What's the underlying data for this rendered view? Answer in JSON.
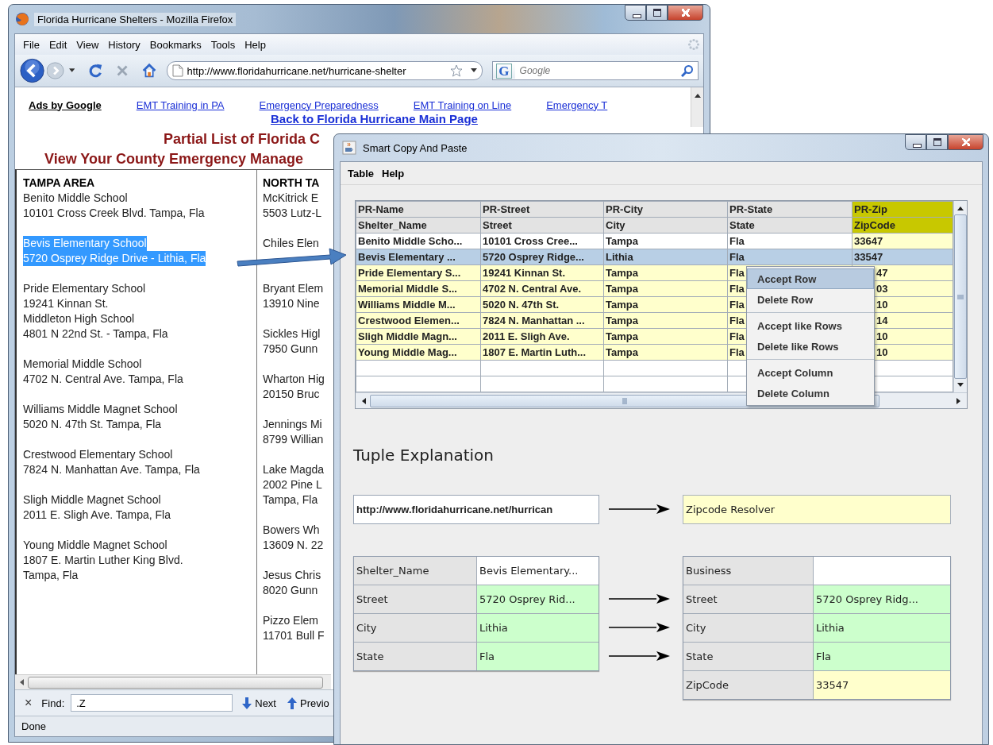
{
  "browser": {
    "title": "Florida Hurricane Shelters - Mozilla Firefox",
    "menu": [
      "File",
      "Edit",
      "View",
      "History",
      "Bookmarks",
      "Tools",
      "Help"
    ],
    "url": "http://www.floridahurricane.net/hurricane-shelter",
    "search_engine": "G",
    "search_placeholder": "Google",
    "ads_label": "Ads by Google",
    "ads": [
      "EMT Training in PA",
      "Emergency Preparedness",
      "EMT Training on Line",
      "Emergency T"
    ],
    "back_link": "Back to Florida Hurricane Main Page",
    "headings": [
      "Partial List of Florida C",
      "View Your County Emergency Manage"
    ],
    "columns": [
      {
        "heading": "TAMPA AREA",
        "entries": [
          {
            "lines": [
              "Benito Middle School",
              "10101 Cross Creek Blvd. Tampa, Fla"
            ],
            "selected": false
          },
          {
            "lines": [
              "Bevis Elementary School",
              "5720 Osprey Ridge Drive - Lithia, Fla"
            ],
            "selected": true
          },
          {
            "lines": [
              "Pride Elementary School",
              "19241 Kinnan St.",
              "Middleton High School",
              "4801 N 22nd St. - Tampa, Fla"
            ],
            "selected": false
          },
          {
            "lines": [
              "Memorial Middle School",
              "4702 N. Central Ave. Tampa, Fla"
            ],
            "selected": false
          },
          {
            "lines": [
              "Williams Middle Magnet School",
              "5020 N. 47th St. Tampa, Fla"
            ],
            "selected": false
          },
          {
            "lines": [
              "Crestwood Elementary School",
              "7824 N. Manhattan Ave. Tampa, Fla"
            ],
            "selected": false
          },
          {
            "lines": [
              "Sligh Middle Magnet School",
              "2011 E. Sligh Ave. Tampa, Fla"
            ],
            "selected": false
          },
          {
            "lines": [
              "Young Middle Magnet School",
              "1807 E. Martin Luther King Blvd.",
              "Tampa, Fla"
            ],
            "selected": false
          }
        ]
      },
      {
        "heading": "NORTH TA",
        "entries": [
          {
            "lines": [
              "McKitrick E",
              "5503 Lutz-L"
            ],
            "selected": false
          },
          {
            "lines": [
              "Chiles Elen"
            ],
            "selected": false
          },
          {
            "lines": [
              "Bryant Elem",
              "13910 Nine"
            ],
            "selected": false
          },
          {
            "lines": [
              "Sickles Higl",
              "7950 Gunn"
            ],
            "selected": false
          },
          {
            "lines": [
              "Wharton Hig",
              "20150 Bruc"
            ],
            "selected": false
          },
          {
            "lines": [
              "Jennings Mi",
              "8799 Willian"
            ],
            "selected": false
          },
          {
            "lines": [
              "Lake Magda",
              "2002 Pine L",
              "Tampa, Fla"
            ],
            "selected": false
          },
          {
            "lines": [
              "Bowers Wh",
              "13609 N. 22"
            ],
            "selected": false
          },
          {
            "lines": [
              "Jesus Chris",
              "8020 Gunn"
            ],
            "selected": false
          },
          {
            "lines": [
              "Pizzo Elem",
              "11701 Bull F"
            ],
            "selected": false
          }
        ]
      }
    ],
    "find": {
      "close": "×",
      "label": "Find:",
      "value": ".Z",
      "next": "Next",
      "previous": "Previo"
    },
    "status": "Done"
  },
  "app": {
    "title": "Smart Copy And Paste",
    "menu": [
      "Table",
      "Help"
    ],
    "table": {
      "columns": [
        {
          "header": "PR-Name",
          "field": "Shelter_Name",
          "selected": false
        },
        {
          "header": "PR-Street",
          "field": "Street",
          "selected": false
        },
        {
          "header": "PR-City",
          "field": "City",
          "selected": false
        },
        {
          "header": "PR-State",
          "field": "State",
          "selected": false
        },
        {
          "header": "PR-Zip",
          "field": "ZipCode",
          "selected": true
        }
      ],
      "rows": [
        {
          "cells": [
            "Benito Middle Scho...",
            "10101 Cross Cree...",
            "Tampa",
            "Fla",
            "33647"
          ],
          "selected": false,
          "highlighted": false
        },
        {
          "cells": [
            "Bevis Elementary ...",
            "5720 Osprey Ridge...",
            "Lithia",
            "Fla",
            "33547"
          ],
          "selected": true,
          "highlighted": false
        },
        {
          "cells": [
            "Pride Elementary S...",
            "19241 Kinnan St.",
            "Tampa",
            "Fla",
            "47"
          ],
          "selected": false,
          "highlighted": true
        },
        {
          "cells": [
            "Memorial Middle S...",
            "4702 N. Central Ave.",
            "Tampa",
            "Fla",
            "03"
          ],
          "selected": false,
          "highlighted": true
        },
        {
          "cells": [
            "Williams Middle M...",
            "5020 N. 47th St.",
            "Tampa",
            "Fla",
            "10"
          ],
          "selected": false,
          "highlighted": true
        },
        {
          "cells": [
            "Crestwood Elemen...",
            "7824 N. Manhattan ...",
            "Tampa",
            "Fla",
            "14"
          ],
          "selected": false,
          "highlighted": true
        },
        {
          "cells": [
            "Sligh Middle Magn...",
            "2011 E. Sligh Ave.",
            "Tampa",
            "Fla",
            "10"
          ],
          "selected": false,
          "highlighted": true
        },
        {
          "cells": [
            "Young Middle Mag...",
            "1807 E. Martin Luth...",
            "Tampa",
            "Fla",
            "10"
          ],
          "selected": false,
          "highlighted": true
        }
      ]
    },
    "context_menu": {
      "groups": [
        [
          {
            "label": "Accept Row",
            "selected": true
          },
          {
            "label": "Delete Row",
            "selected": false
          }
        ],
        [
          {
            "label": "Accept like Rows",
            "selected": false
          },
          {
            "label": "Delete like Rows",
            "selected": false
          }
        ],
        [
          {
            "label": "Accept Column",
            "selected": false
          },
          {
            "label": "Delete Column",
            "selected": false
          }
        ]
      ]
    },
    "tuple": {
      "title": "Tuple Explanation",
      "source": "http://www.floridahurricane.net/hurrican",
      "service": "Zipcode Resolver",
      "input": [
        {
          "name": "Shelter_Name",
          "value": "Bevis Elementary...",
          "kind": "plain"
        },
        {
          "name": "Street",
          "value": "5720 Osprey Rid...",
          "kind": "mapped"
        },
        {
          "name": "City",
          "value": "Lithia",
          "kind": "mapped"
        },
        {
          "name": "State",
          "value": "Fla",
          "kind": "mapped"
        }
      ],
      "output": [
        {
          "name": "Business",
          "kind": "plain"
        },
        {
          "name": "Street",
          "value": "5720 Osprey Ridg...",
          "kind": "mapped"
        },
        {
          "name": "City",
          "value": "Lithia",
          "kind": "mapped"
        },
        {
          "name": "State",
          "value": "Fla",
          "kind": "mapped"
        },
        {
          "name": "ZipCode",
          "value": "33547",
          "kind": "resolved"
        }
      ]
    }
  }
}
